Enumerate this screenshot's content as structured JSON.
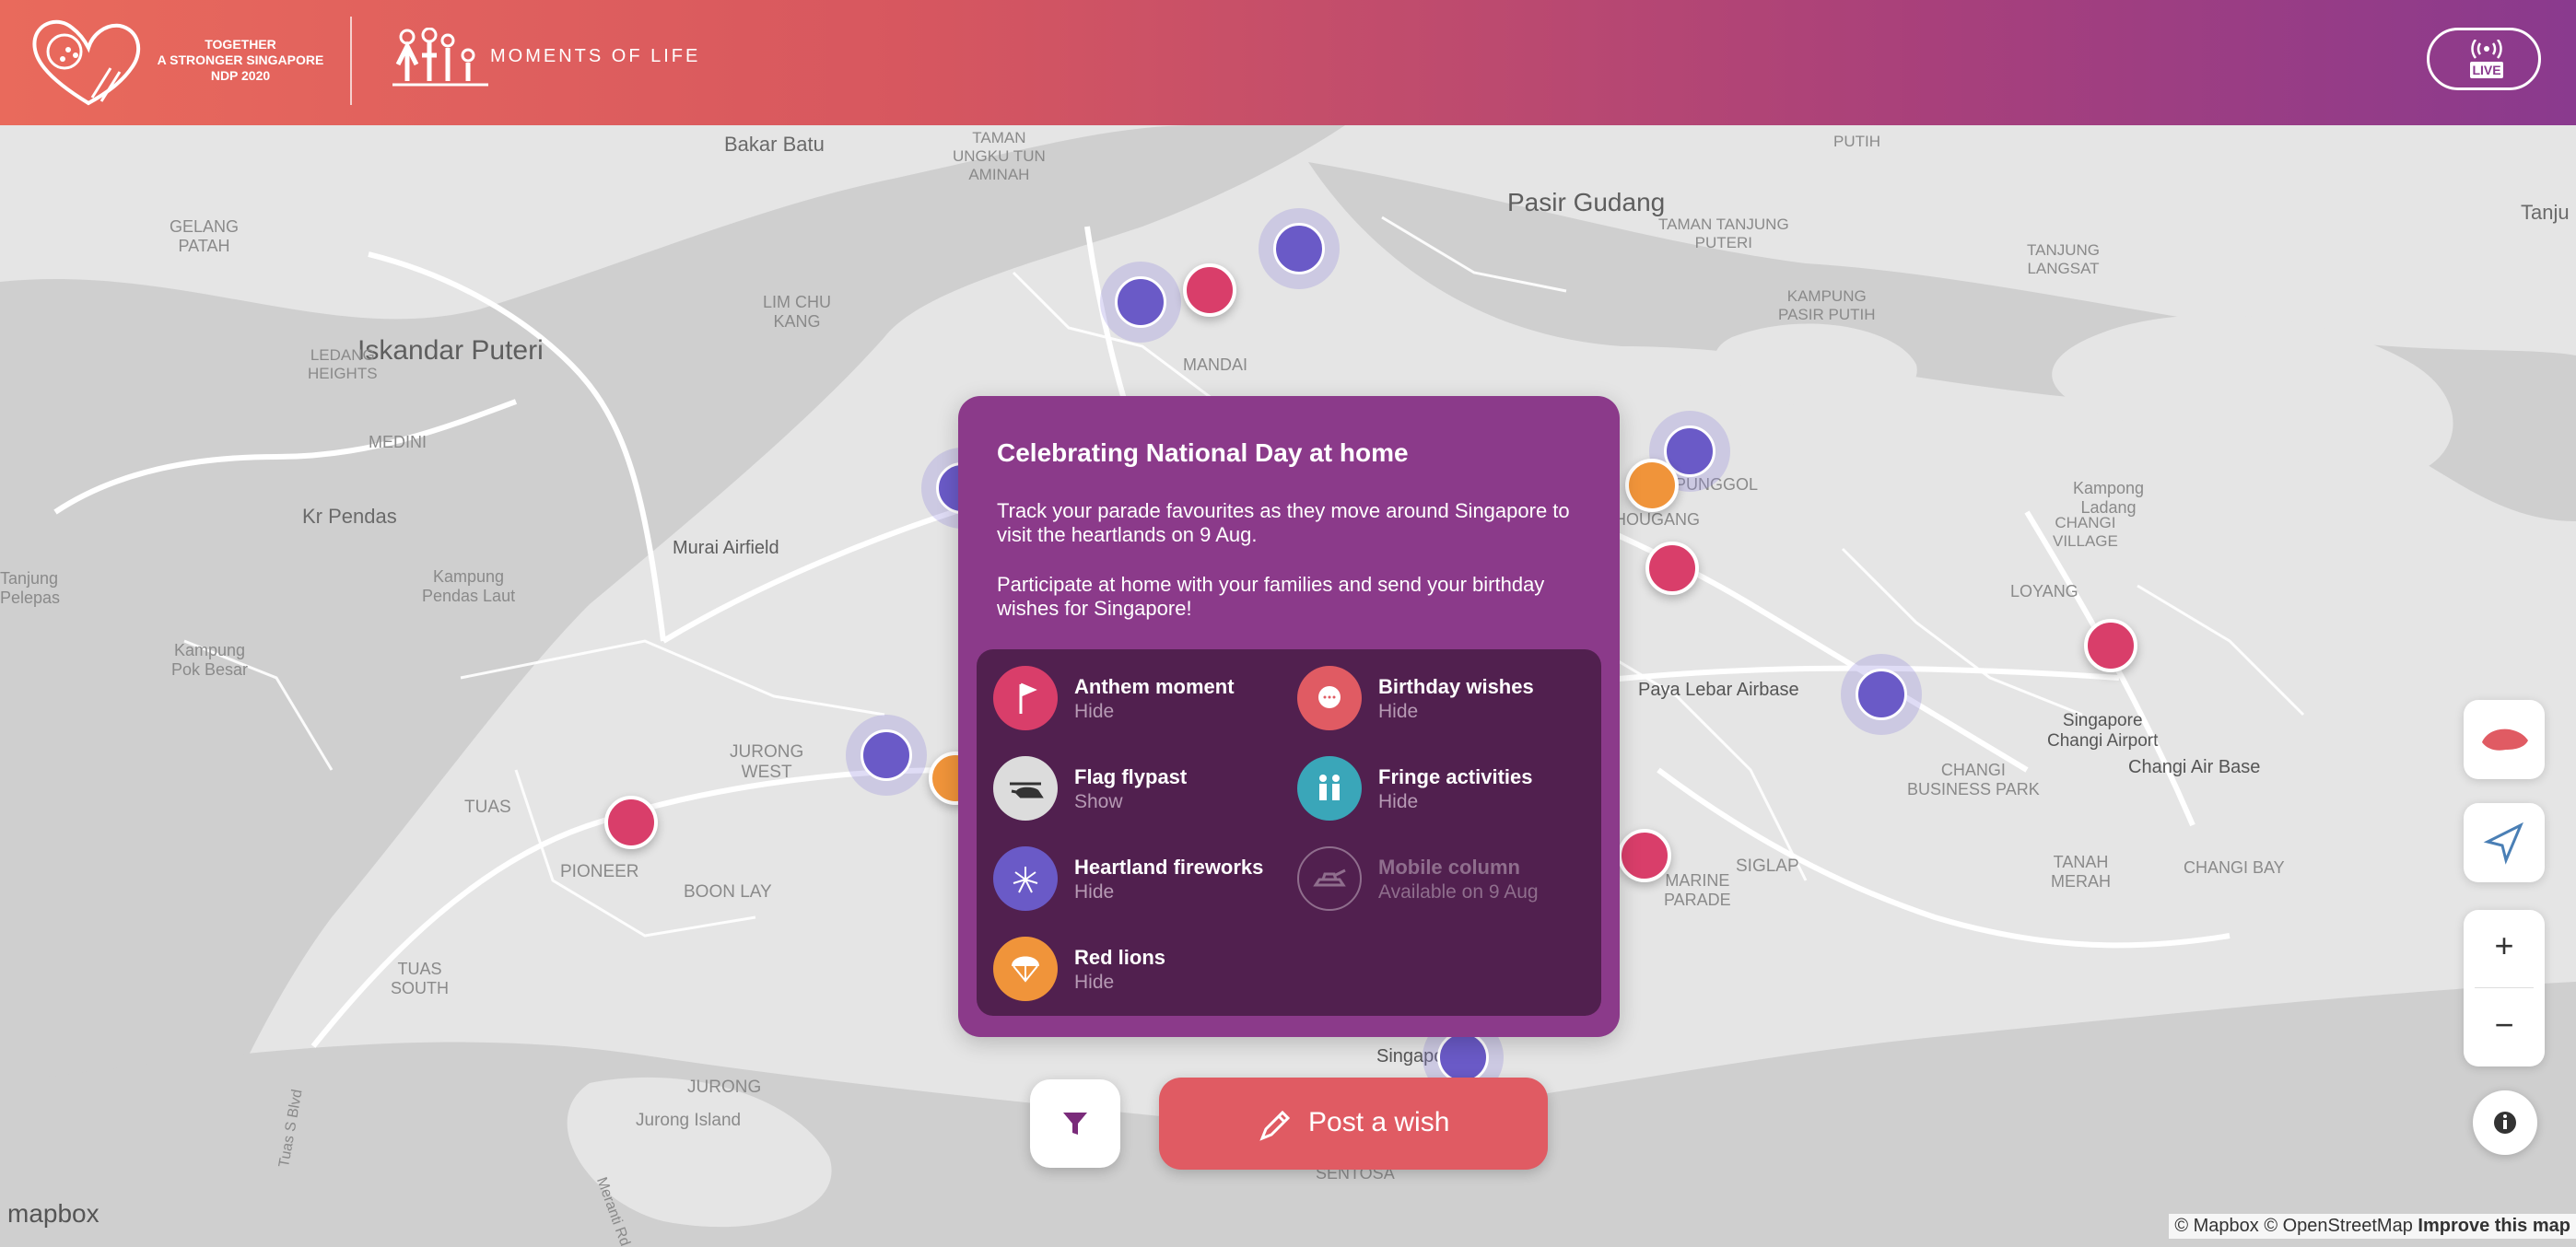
{
  "header": {
    "logo_text_1": "TOGETHER",
    "logo_text_2": "A STRONGER SINGAPORE",
    "logo_text_3": "NDP 2020",
    "title": "MOMENTS OF LIFE",
    "live_label": "LIVE",
    "gradient": [
      "#e96a5c",
      "#8a3a8e"
    ]
  },
  "map": {
    "places": {
      "bakar_batu": "Bakar Batu",
      "taman_ungku_tun_aminah": "TAMAN\nUNGKU TUN\nAMINAH",
      "pasir_gudang": "Pasir Gudang",
      "taman_tanjung_puteri": "TAMAN TANJUNG\nPUTERI",
      "tanjung_langsat": "TANJUNG\nLANGSAT",
      "kampung_pasir_putih": "KAMPUNG\nPASIR PUTIH",
      "putih": "PUTIH",
      "tanju": "Tanju",
      "gelang_patah": "GELANG\nPATAH",
      "iskandar_puteri": "Iskandar Puteri",
      "lim_chu_kang": "LIM CHU\nKANG",
      "ledang_heights": "LEDANG\nHEIGHTS",
      "medini": "MEDINI",
      "mandai": "MANDAI",
      "kampong_ladang": "Kampong\nLadang",
      "kr_pendas": "Kr Pendas",
      "murai_airfield": "Murai Airfield",
      "tanjung_pelepas": "Tanjung\nPelepas",
      "kampung_pendas_laut": "Kampung\nPendas Laut",
      "kampung_pok_besar": "Kampung\nPok Besar",
      "jurong_west": "JURONG\nWEST",
      "tuas": "TUAS",
      "pioneer": "PIONEER",
      "boon_lay": "BOON LAY",
      "tuas_south": "TUAS\nSOUTH",
      "jurong": "JURONG",
      "jurong_island": "Jurong Island",
      "tuas_s_blvd": "Tuas S Blvd",
      "meranti_rd": "Meranti Rd",
      "punggol": "PUNGGOL",
      "hougang": "HOUGANG",
      "paya_lebar_airbase": "Paya Lebar Airbase",
      "loyang": "LOYANG",
      "changi_village": "CHANGI\nVILLAGE",
      "singapore_changi_airport": "Singapore\nChangi Airport",
      "changi_air_base": "Changi Air Base",
      "changi_business_park": "CHANGI\nBUSINESS PARK",
      "tanah_merah": "TANAH\nMERAH",
      "changi_bay": "CHANGI BAY",
      "siglap": "SIGLAP",
      "marine_parade": "MARINE\nPARADE",
      "singapore": "Singapore",
      "sentosa": "SENTOSA"
    }
  },
  "popup": {
    "title": "Celebrating National Day at home",
    "paragraph_1": "Track your parade favourites as they move around Singapore to visit the heartlands on 9 Aug.",
    "paragraph_2": "Participate at home with your families and send your birthday wishes for Singapore!",
    "legend": [
      {
        "label": "Anthem moment",
        "status": "Hide",
        "icon": "flag-icon",
        "color": "#d93e6a"
      },
      {
        "label": "Birthday wishes",
        "status": "Hide",
        "icon": "chat-bubble-icon",
        "color": "#e05b63"
      },
      {
        "label": "Flag flypast",
        "status": "Show",
        "icon": "helicopter-icon",
        "color": "#dcdcdc"
      },
      {
        "label": "Fringe activities",
        "status": "Hide",
        "icon": "people-icon",
        "color": "#3aa6b9"
      },
      {
        "label": "Heartland fireworks",
        "status": "Hide",
        "icon": "fireworks-icon",
        "color": "#6a5ac7"
      },
      {
        "label": "Mobile column",
        "status": "Available on 9 Aug",
        "icon": "tank-icon",
        "color": "#51204f"
      },
      {
        "label": "Red lions",
        "status": "Hide",
        "icon": "parachute-icon",
        "color": "#f0943a"
      }
    ]
  },
  "actions": {
    "post_wish_label": "Post a wish"
  },
  "controls": {
    "zoom_in": "+",
    "zoom_out": "−"
  },
  "footer": {
    "mapbox": "mapbox",
    "attribution": "© Mapbox © OpenStreetMap",
    "improve": "Improve this map"
  }
}
